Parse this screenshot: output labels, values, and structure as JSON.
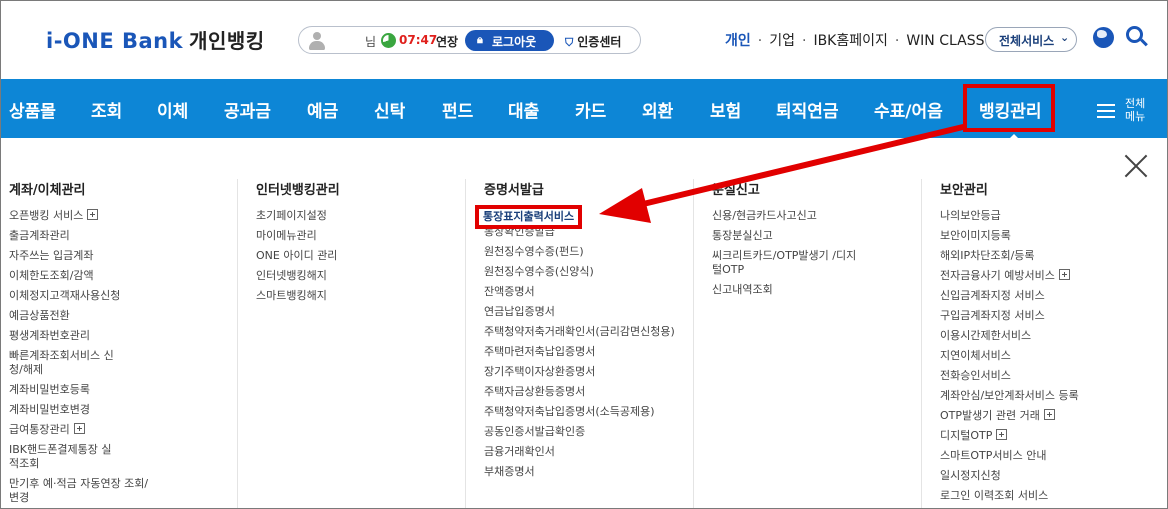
{
  "header": {
    "logo_main": "i-ONE Bank",
    "logo_sub": "개인뱅킹",
    "session": {
      "user_suffix": "님",
      "timer": "07:47",
      "extend": "연장",
      "logout": "로그아웃",
      "cert_center": "인증센터"
    },
    "top_links": [
      "개인",
      "기업",
      "IBK홈페이지",
      "WIN CLASS"
    ],
    "all_services": "전체서비스"
  },
  "gnb": {
    "items": [
      "상품몰",
      "조회",
      "이체",
      "공과금",
      "예금",
      "신탁",
      "펀드",
      "대출",
      "카드",
      "외환",
      "보험",
      "퇴직연금",
      "수표/어음",
      "뱅킹관리"
    ],
    "full_menu": [
      "전체",
      "메뉴"
    ]
  },
  "menu_columns": [
    {
      "title": "계좌/이체관리",
      "items": [
        "오픈뱅킹 서비스",
        "출금계좌관리",
        "자주쓰는 입금계좌",
        "이체한도조회/감액",
        "이체정지고객재사용신청",
        "예금상품전환",
        "평생계좌번호관리",
        "빠른계좌조회서비스 신청/해제",
        "계좌비밀번호등록",
        "계좌비밀번호변경",
        "급여통장관리",
        "IBK핸드폰결제통장 실적조회",
        "만기후 예·적금 자동연장 조회/변경"
      ]
    },
    {
      "title": "인터넷뱅킹관리",
      "items": [
        "초기페이지설정",
        "마이메뉴관리",
        "ONE 아이디 관리",
        "인터넷뱅킹해지",
        "스마트뱅킹해지"
      ]
    },
    {
      "title": "증명서발급",
      "items": [
        "통장표지출력서비스",
        "통장확인증발급",
        "원천징수영수증(펀드)",
        "원천징수영수증(신양식)",
        "잔액증명서",
        "연금납입증명서",
        "주택청약저축거래확인서(금리감면신청용)",
        "주택마련저축납입증명서",
        "장기주택이자상환증명서",
        "주택자금상환등증명서",
        "주택청약저축납입증명서(소득공제용)",
        "공동인증서발급확인증",
        "금융거래확인서",
        "부채증명서"
      ]
    },
    {
      "title": "분실신고",
      "items": [
        "신용/현금카드사고신고",
        "통장분실신고",
        "씨크리트카드/OTP발생기 /디지털OTP",
        "신고내역조회"
      ]
    },
    {
      "title": "보안관리",
      "items": [
        "나의보안등급",
        "보안이미지등록",
        "해외IP차단조회/등록",
        "전자금융사기 예방서비스",
        "신입금계좌지정 서비스",
        "구입금계좌지정 서비스",
        "이용시간제한서비스",
        "지연이체서비스",
        "전화승인서비스",
        "계좌안심/보안계좌서비스 등록",
        "OTP발생기 관련 거래",
        "디지털OTP",
        "스마트OTP서비스 안내",
        "일시정지신청",
        "로그인 이력조회 서비스"
      ]
    }
  ],
  "colors": {
    "brand_blue": "#1a56b8",
    "gnb_bg": "#0d86d6",
    "annotation_red": "#e10000"
  }
}
